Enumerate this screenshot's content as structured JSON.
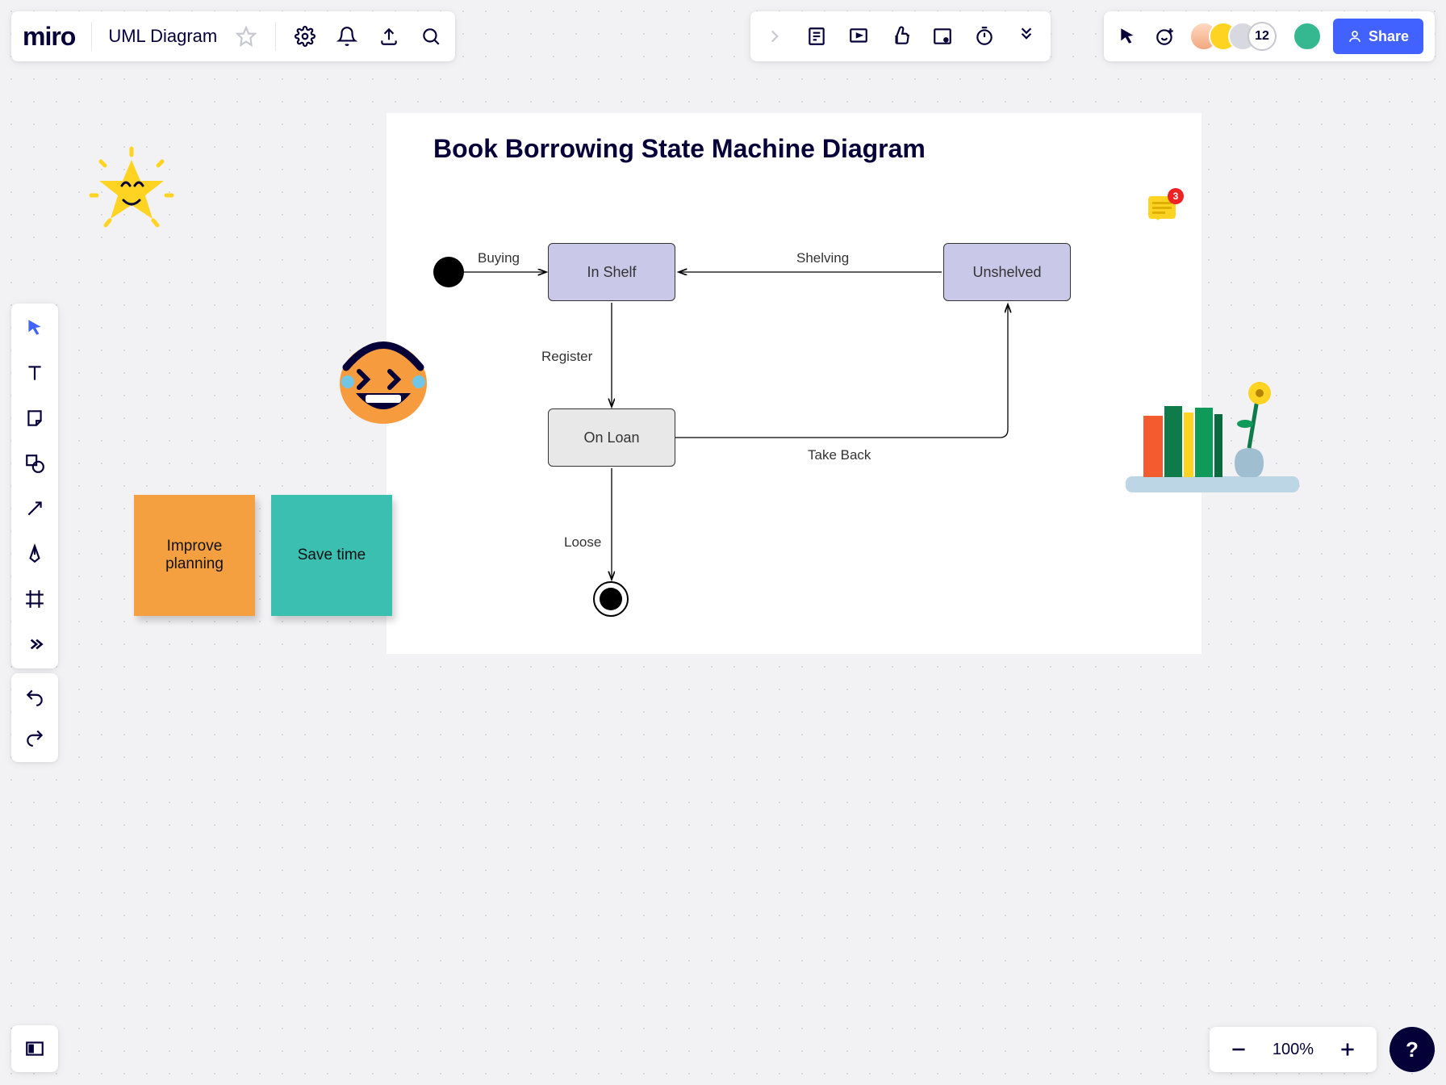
{
  "app": {
    "logo": "miro",
    "board_title": "UML Diagram"
  },
  "share": {
    "label": "Share",
    "extra_count": "12"
  },
  "zoom": {
    "percent": "100%"
  },
  "comments": {
    "count": "3"
  },
  "frame": {
    "title": "Book Borrowing State Machine Diagram",
    "states": {
      "in_shelf": "In Shelf",
      "unshelved": "Unshelved",
      "on_loan": "On Loan"
    },
    "transitions": {
      "buying": "Buying",
      "shelving": "Shelving",
      "register": "Register",
      "take_back": "Take Back",
      "loose": "Loose"
    }
  },
  "sticky": {
    "improve": "Improve planning",
    "save_time": "Save time"
  },
  "chart_data": {
    "type": "state-machine",
    "title": "Book Borrowing State Machine Diagram",
    "initial": "In Shelf",
    "final_from": "On Loan",
    "states": [
      "In Shelf",
      "Unshelved",
      "On Loan"
    ],
    "transitions": [
      {
        "from": "__initial__",
        "to": "In Shelf",
        "label": "Buying"
      },
      {
        "from": "Unshelved",
        "to": "In Shelf",
        "label": "Shelving"
      },
      {
        "from": "In Shelf",
        "to": "On Loan",
        "label": "Register"
      },
      {
        "from": "On Loan",
        "to": "Unshelved",
        "label": "Take Back"
      },
      {
        "from": "On Loan",
        "to": "__final__",
        "label": "Loose"
      }
    ]
  }
}
